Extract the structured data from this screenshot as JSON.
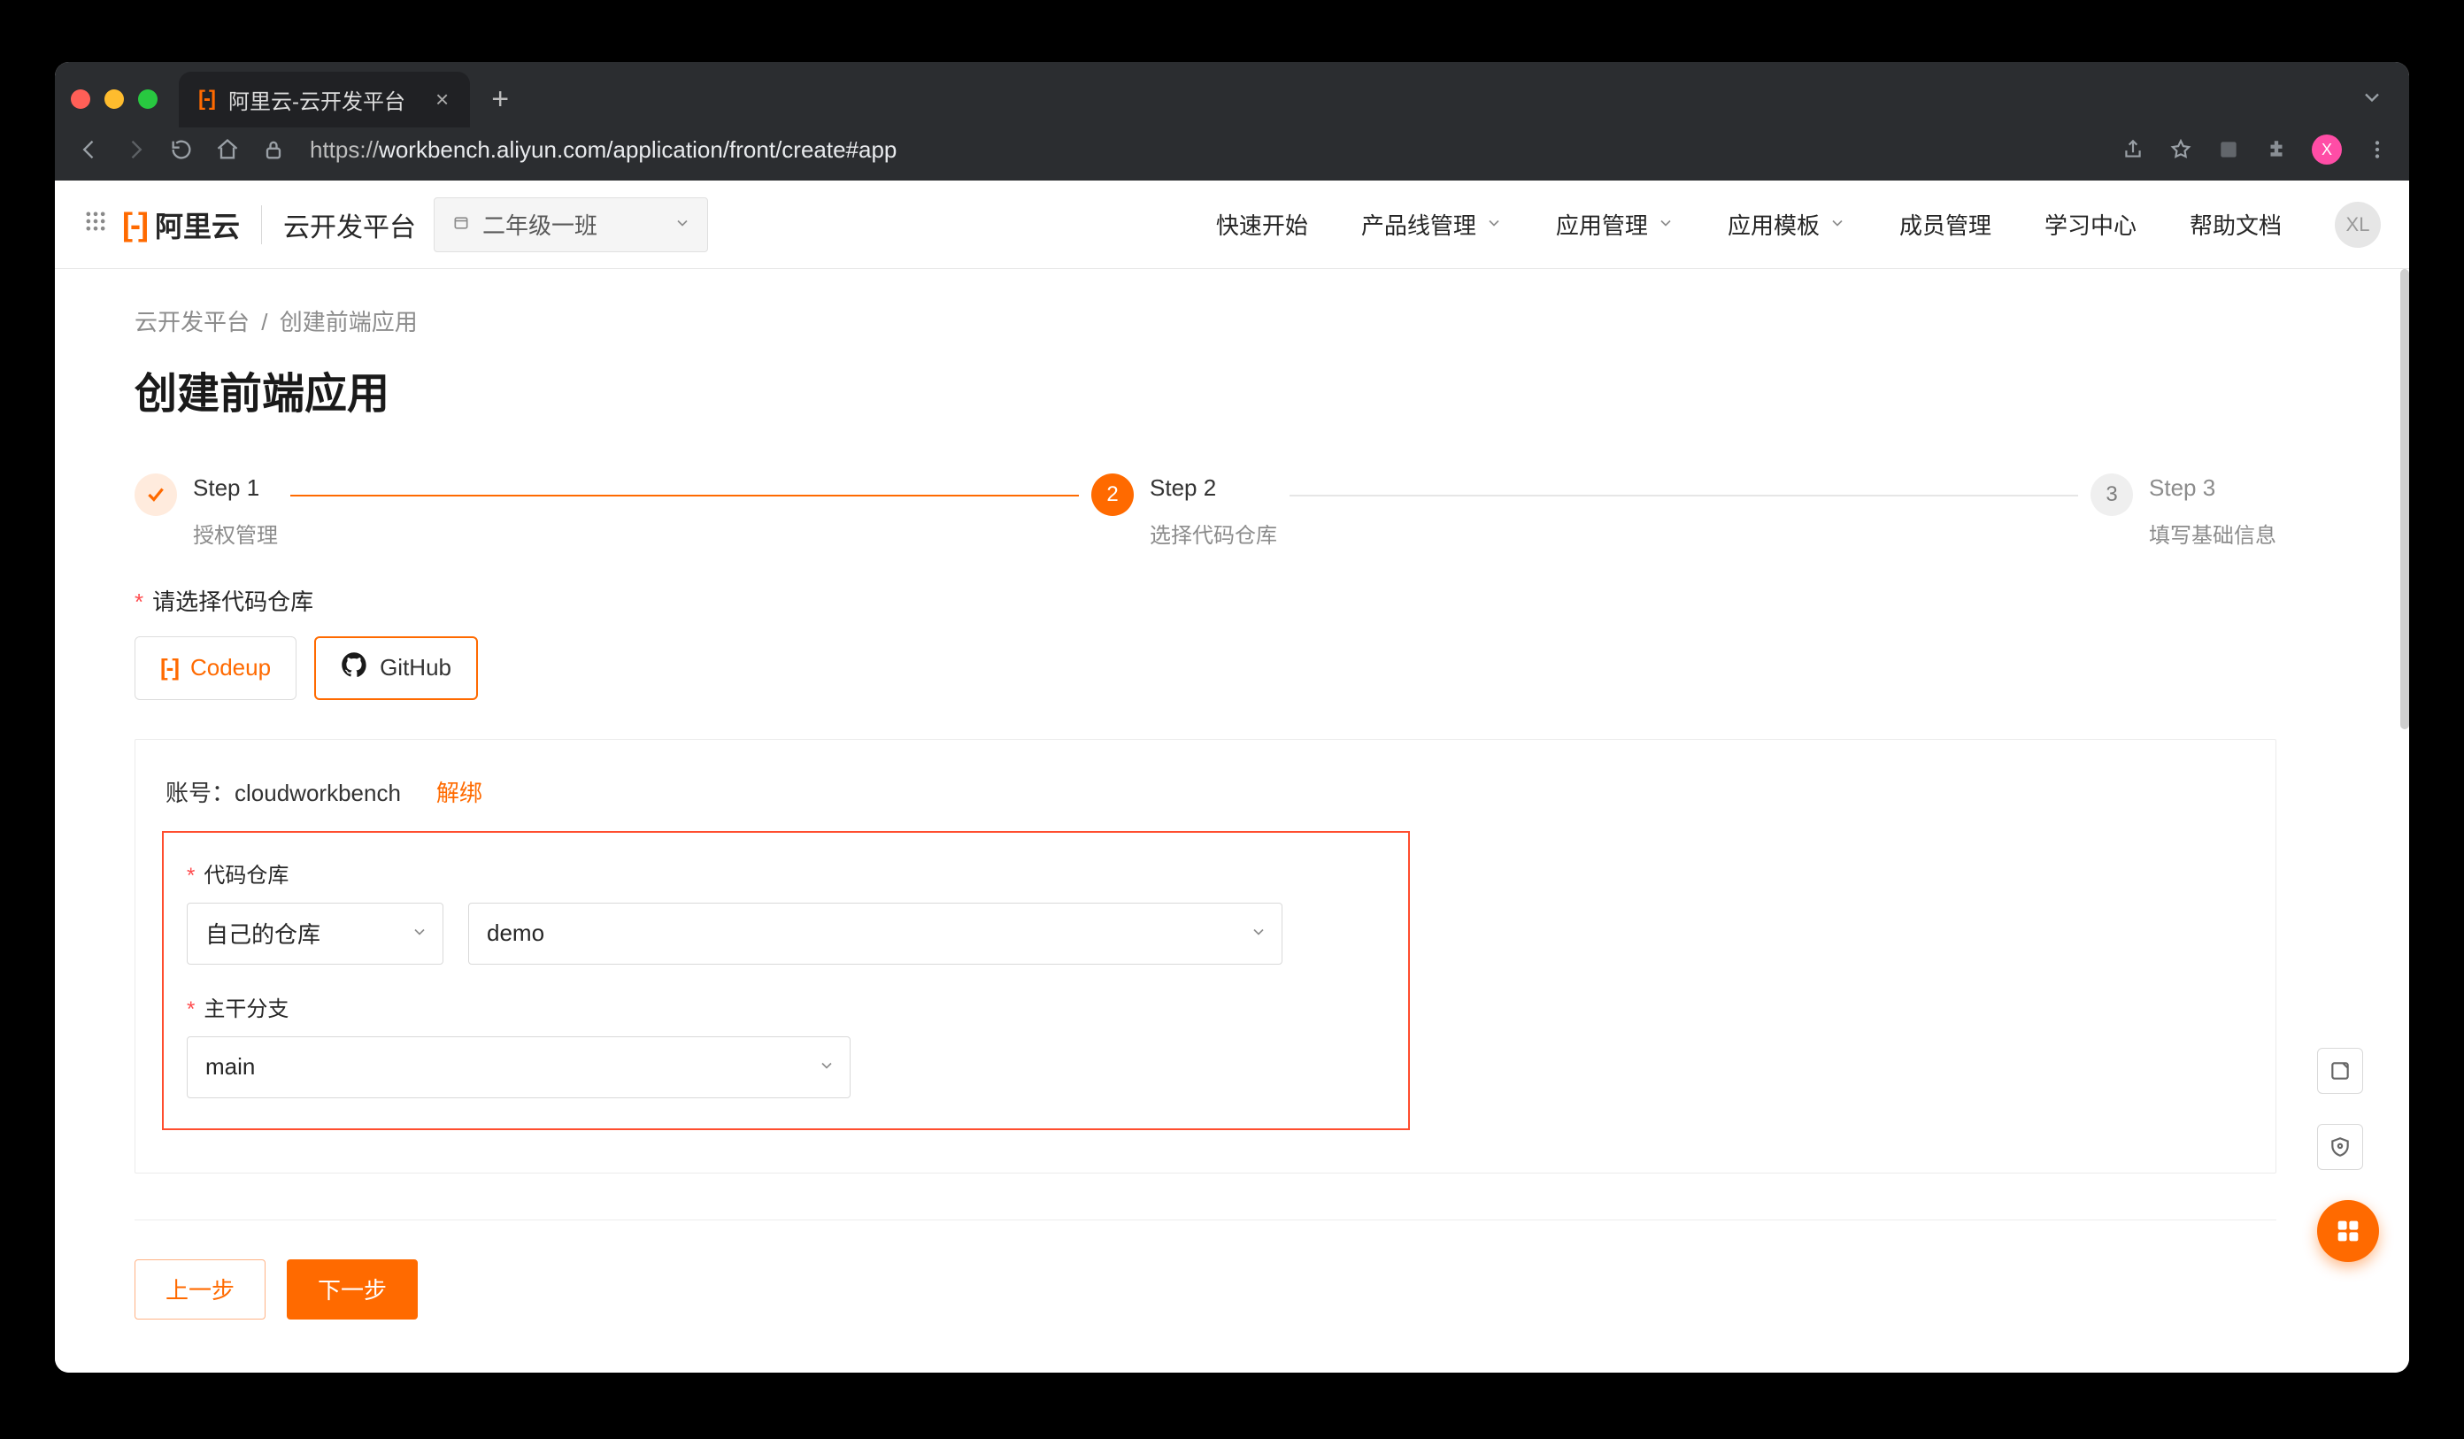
{
  "browser": {
    "tab_title": "阿里云-云开发平台",
    "url_display": "workbench.aliyun.com/application/front/create#app",
    "avatar_letter": "X"
  },
  "topbar": {
    "brand": "阿里云",
    "platform": "云开发平台",
    "class_value": "二年级一班",
    "nav": {
      "quickstart": "快速开始",
      "product": "产品线管理",
      "app_mgmt": "应用管理",
      "app_tmpl": "应用模板",
      "member": "成员管理",
      "learn": "学习中心",
      "help": "帮助文档"
    },
    "user_badge": "XL"
  },
  "crumbs": {
    "root": "云开发平台",
    "leaf": "创建前端应用"
  },
  "title": "创建前端应用",
  "steps": {
    "s1": {
      "title": "Step 1",
      "desc": "授权管理"
    },
    "s2": {
      "title": "Step 2",
      "desc": "选择代码仓库",
      "num": "2"
    },
    "s3": {
      "title": "Step 3",
      "desc": "填写基础信息",
      "num": "3"
    }
  },
  "repo": {
    "select_label": "请选择代码仓库",
    "codeup": "Codeup",
    "github": "GitHub"
  },
  "account": {
    "prefix": "账号：",
    "name": "cloudworkbench",
    "unbind": "解绑"
  },
  "fields": {
    "repo_label": "代码仓库",
    "repo_owner": "自己的仓库",
    "repo_name": "demo",
    "branch_label": "主干分支",
    "branch": "main"
  },
  "actions": {
    "prev": "上一步",
    "next": "下一步"
  }
}
